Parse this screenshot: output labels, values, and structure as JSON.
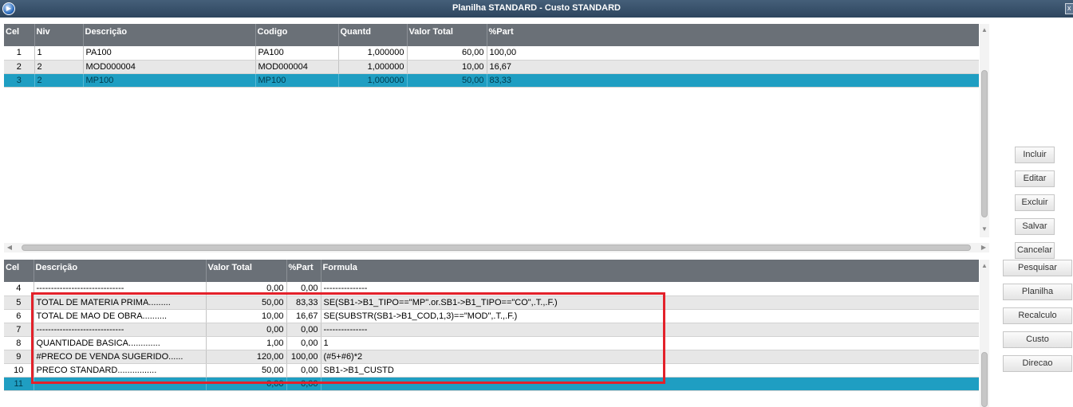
{
  "window": {
    "title": "Planilha STANDARD - Custo STANDARD",
    "close_glyph": "x"
  },
  "top_grid": {
    "columns": [
      "Cel",
      "Niv",
      "Descrição",
      "Codigo",
      "Quantd",
      "Valor Total",
      "%Part"
    ],
    "rows": [
      {
        "cel": "1",
        "niv": "1",
        "descricao": "PA100",
        "codigo": "PA100",
        "quantd": "1,000000",
        "valor_total": "60,00",
        "part": "100,00"
      },
      {
        "cel": "2",
        "niv": "2",
        "descricao": "MOD000004",
        "codigo": "MOD000004",
        "quantd": "1,000000",
        "valor_total": "10,00",
        "part": "16,67"
      },
      {
        "cel": "3",
        "niv": "2",
        "descricao": "MP100",
        "codigo": "MP100",
        "quantd": "1,000000",
        "valor_total": "50,00",
        "part": "83,33"
      }
    ],
    "selected_row": 3
  },
  "bottom_grid": {
    "columns": [
      "Cel",
      "Descrição",
      "Valor Total",
      "%Part",
      "Formula"
    ],
    "rows": [
      {
        "cel": "4",
        "descricao": "------------------------------",
        "valor_total": "0,00",
        "part": "0,00",
        "formula": "---------------"
      },
      {
        "cel": "5",
        "descricao": "TOTAL DE MATERIA PRIMA.........",
        "valor_total": "50,00",
        "part": "83,33",
        "formula": "SE(SB1->B1_TIPO==\"MP\".or.SB1->B1_TIPO==\"CO\",.T.,.F.)"
      },
      {
        "cel": "6",
        "descricao": "TOTAL DE MAO DE OBRA..........",
        "valor_total": "10,00",
        "part": "16,67",
        "formula": "SE(SUBSTR(SB1->B1_COD,1,3)==\"MOD\",.T.,.F.)"
      },
      {
        "cel": "7",
        "descricao": "------------------------------",
        "valor_total": "0,00",
        "part": "0,00",
        "formula": "---------------"
      },
      {
        "cel": "8",
        "descricao": "QUANTIDADE BASICA.............",
        "valor_total": "1,00",
        "part": "0,00",
        "formula": "1"
      },
      {
        "cel": "9",
        "descricao": "#PRECO DE VENDA SUGERIDO......",
        "valor_total": "120,00",
        "part": "100,00",
        "formula": "(#5+#6)*2"
      },
      {
        "cel": "10",
        "descricao": "PRECO STANDARD................",
        "valor_total": "50,00",
        "part": "0,00",
        "formula": "SB1->B1_CUSTD"
      },
      {
        "cel": "11",
        "descricao": "",
        "valor_total": "0,00",
        "part": "0,00",
        "formula": ""
      }
    ],
    "selected_row": 11
  },
  "buttons": {
    "incluir": "Incluir",
    "editar": "Editar",
    "excluir": "Excluir",
    "salvar": "Salvar",
    "cancelar": "Cancelar",
    "pesquisar": "Pesquisar",
    "planilha": "Planilha",
    "recalculo": "Recalculo",
    "custo": "Custo",
    "direcao": "Direcao"
  },
  "highlight": {
    "color": "#e3212a"
  },
  "colors": {
    "selected_row": "#1f9ec2",
    "header": "#6a7077",
    "titlebar": "#2d455e"
  }
}
